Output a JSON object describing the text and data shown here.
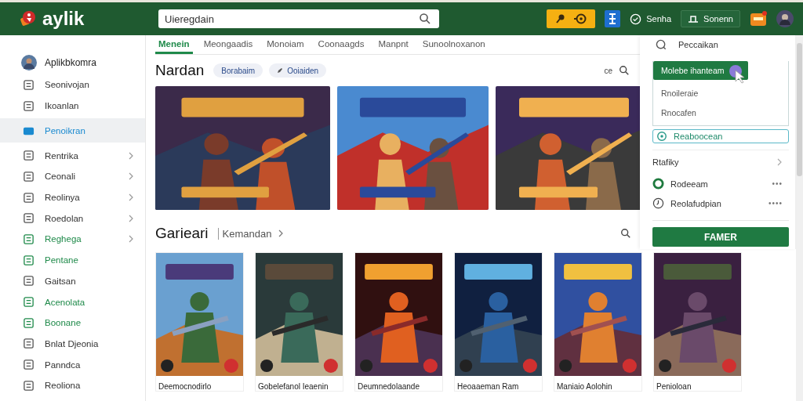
{
  "header": {
    "logo": "aylik",
    "search": {
      "value": "Uieregdain"
    },
    "status": "Senha",
    "outline_button": "Sonenn"
  },
  "sidebar": {
    "profile": "Aplikbkomra",
    "items": [
      {
        "label": "Seonivojan",
        "selected": false,
        "expandable": false,
        "accent": false
      },
      {
        "label": "Ikoanlan",
        "selected": false,
        "expandable": false,
        "accent": false
      },
      {
        "label": "Penoikran",
        "selected": true,
        "expandable": false,
        "accent": false
      },
      {
        "label": "Rentrika",
        "selected": false,
        "expandable": true,
        "accent": false
      },
      {
        "label": "Ceonali",
        "selected": false,
        "expandable": true,
        "accent": false
      },
      {
        "label": "Reolinya",
        "selected": false,
        "expandable": true,
        "accent": false
      },
      {
        "label": "Roedolan",
        "selected": false,
        "expandable": true,
        "accent": false
      },
      {
        "label": "Reghega",
        "selected": false,
        "expandable": true,
        "accent": true
      },
      {
        "label": "Pentane",
        "selected": false,
        "expandable": false,
        "accent": true
      },
      {
        "label": "Gaitsan",
        "selected": false,
        "expandable": false,
        "accent": false
      },
      {
        "label": "Acenolata",
        "selected": false,
        "expandable": false,
        "accent": true
      },
      {
        "label": "Boonane",
        "selected": false,
        "expandable": false,
        "accent": true
      },
      {
        "label": "Bnlat Djeonia",
        "selected": false,
        "expandable": false,
        "accent": false
      },
      {
        "label": "Panndca",
        "selected": false,
        "expandable": false,
        "accent": false
      },
      {
        "label": "Reoliona",
        "selected": false,
        "expandable": false,
        "accent": false
      }
    ]
  },
  "tabs": [
    {
      "label": "Menein",
      "selected": true
    },
    {
      "label": "Meongaadis",
      "selected": false
    },
    {
      "label": "Monoiam",
      "selected": false
    },
    {
      "label": "Coonaagds",
      "selected": false
    },
    {
      "label": "Manpnt",
      "selected": false
    },
    {
      "label": "Sunoolnoxanon",
      "selected": false
    }
  ],
  "featured": {
    "title": "Nardan",
    "chips": [
      "Borabaim",
      "Ooiaiden"
    ],
    "mark": "ce",
    "banners": [
      {
        "kind": "picture"
      },
      {
        "kind": "picture"
      },
      {
        "kind": "picture"
      }
    ]
  },
  "games": {
    "title": "Garieari",
    "link": "Kemandan",
    "cards": [
      {
        "title": "Deemocnodirlo"
      },
      {
        "title": "Gobelefanol Ieaenin"
      },
      {
        "title": "Deumnedolaande"
      },
      {
        "title": "Heoaaeman Ram"
      },
      {
        "title": "Maniaio Aolohin"
      },
      {
        "title": "Penioloan"
      }
    ]
  },
  "panel": {
    "search": "Peccaikan",
    "primary": "Molebe ihanteam",
    "options": [
      "Rnoileraie",
      "Rnocafen"
    ],
    "field": "Reaboocean",
    "section": "Rtafiky",
    "rows": [
      {
        "label": "Rodeeam",
        "more": "•••"
      },
      {
        "label": "Reolafudpian",
        "more": "••••"
      }
    ],
    "button": "FAMER"
  }
}
